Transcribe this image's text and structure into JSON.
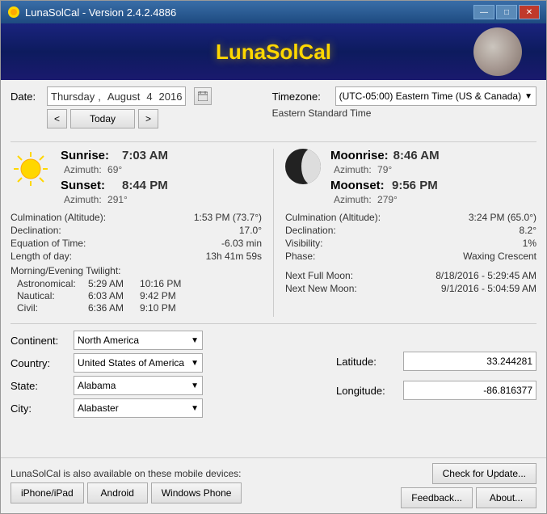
{
  "window": {
    "title": "LunaSolCal - Version 2.4.2.4886"
  },
  "banner": {
    "title": "LunaSolCal"
  },
  "date": {
    "label": "Date:",
    "day": "Thursday",
    "month": "August",
    "day_num": "4",
    "year": "2016"
  },
  "nav": {
    "prev": "<",
    "today": "Today",
    "next": ">"
  },
  "timezone": {
    "label": "Timezone:",
    "value": "(UTC-05:00) Eastern Time (US & Canada)",
    "sub": "Eastern Standard Time"
  },
  "sun": {
    "sunrise_label": "Sunrise:",
    "sunrise_time": "7:03 AM",
    "sunrise_azimuth": "Azimuth:",
    "sunrise_az_val": "69°",
    "sunset_label": "Sunset:",
    "sunset_time": "8:44 PM",
    "sunset_azimuth": "Azimuth:",
    "sunset_az_val": "291°",
    "culmination_label": "Culmination (Altitude):",
    "culmination_val": "1:53 PM (73.7°)",
    "declination_label": "Declination:",
    "declination_val": "17.0°",
    "eq_time_label": "Equation of Time:",
    "eq_time_val": "-6.03 min",
    "length_label": "Length of day:",
    "length_val": "13h 41m 59s"
  },
  "twilight": {
    "title": "Morning/Evening Twilight:",
    "astronomical_label": "Astronomical:",
    "astronomical_morning": "5:29 AM",
    "astronomical_evening": "10:16 PM",
    "nautical_label": "Nautical:",
    "nautical_morning": "6:03 AM",
    "nautical_evening": "9:42 PM",
    "civil_label": "Civil:",
    "civil_morning": "6:36 AM",
    "civil_evening": "9:10 PM"
  },
  "moon": {
    "moonrise_label": "Moonrise:",
    "moonrise_time": "8:46 AM",
    "moonrise_azimuth": "Azimuth:",
    "moonrise_az_val": "79°",
    "moonset_label": "Moonset:",
    "moonset_time": "9:56 PM",
    "moonset_azimuth": "Azimuth:",
    "moonset_az_val": "279°",
    "culmination_label": "Culmination (Altitude):",
    "culmination_val": "3:24 PM (65.0°)",
    "declination_label": "Declination:",
    "declination_val": "8.2°",
    "visibility_label": "Visibility:",
    "visibility_val": "1%",
    "phase_label": "Phase:",
    "phase_val": "Waxing Crescent",
    "next_full_label": "Next Full Moon:",
    "next_full_val": "8/18/2016 - 5:29:45 AM",
    "next_new_label": "Next New Moon:",
    "next_new_val": "9/1/2016 - 5:04:59 AM"
  },
  "location": {
    "continent_label": "Continent:",
    "continent_val": "North America",
    "country_label": "Country:",
    "country_val": "United States of America",
    "state_label": "State:",
    "state_val": "Alabama",
    "city_label": "City:",
    "city_val": "Alabaster",
    "latitude_label": "Latitude:",
    "latitude_val": "33.244281",
    "longitude_label": "Longitude:",
    "longitude_val": "-86.816377"
  },
  "footer": {
    "mobile_text": "LunaSolCal is also available on these mobile devices:",
    "iphone_btn": "iPhone/iPad",
    "android_btn": "Android",
    "windows_phone_btn": "Windows Phone",
    "check_update_btn": "Check for Update...",
    "feedback_btn": "Feedback...",
    "about_btn": "About..."
  },
  "title_controls": {
    "minimize": "—",
    "maximize": "□",
    "close": "✕"
  }
}
